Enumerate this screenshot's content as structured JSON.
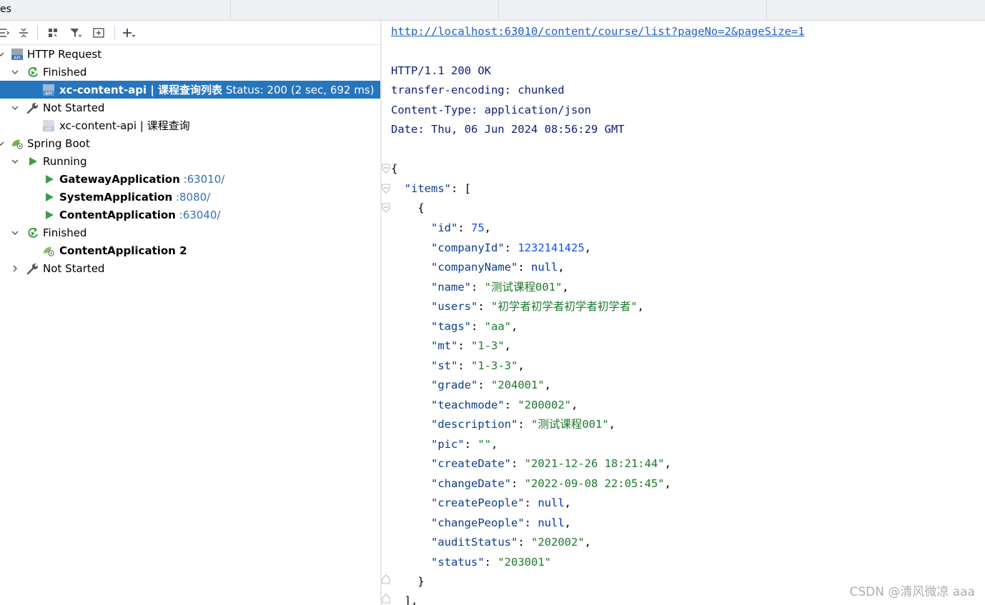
{
  "tabs": [
    "es",
    "",
    "",
    ""
  ],
  "toolbar": {
    "buttons": [
      "expand-all-icon",
      "collapse-all-icon",
      "group-icon",
      "filter-icon",
      "new-window-icon",
      "add-icon"
    ]
  },
  "tree": {
    "http_request": "HTTP Request",
    "finished": "Finished",
    "selected_request_name": "xc-content-api",
    "selected_request_sep": " | ",
    "selected_request_desc": "课程查询列表",
    "selected_request_status": " Status: 200 (2 sec, 692 ms)",
    "not_started": "Not Started",
    "pending_request_name": "xc-content-api",
    "pending_request_sep": " | ",
    "pending_request_desc": "课程查询",
    "spring_boot": "Spring Boot",
    "running": "Running",
    "apps": [
      {
        "name": "GatewayApplication",
        "port": " :63010/"
      },
      {
        "name": "SystemApplication",
        "port": " :8080/"
      },
      {
        "name": "ContentApplication",
        "port": " :63040/"
      }
    ],
    "finished2": "Finished",
    "finished_app": "ContentApplication 2",
    "not_started2": "Not Started"
  },
  "response": {
    "url": "http://localhost:63010/content/course/list?pageNo=2&pageSize=1",
    "status_line": "HTTP/1.1 200 OK",
    "headers": [
      "transfer-encoding: chunked",
      "Content-Type: application/json",
      "Date: Thu, 06 Jun 2024 08:56:29 GMT"
    ],
    "open_brace": "{",
    "items_key": "\"items\"",
    "items_open": ": [",
    "item_open": "{",
    "fields": [
      {
        "key": "\"id\"",
        "val": "75",
        "t": "n",
        "comma": ","
      },
      {
        "key": "\"companyId\"",
        "val": "1232141425",
        "t": "n",
        "comma": ","
      },
      {
        "key": "\"companyName\"",
        "val": "null",
        "t": "kw",
        "comma": ","
      },
      {
        "key": "\"name\"",
        "val": "\"测试课程001\"",
        "t": "s",
        "comma": ","
      },
      {
        "key": "\"users\"",
        "val": "\"初学者初学者初学者初学者\"",
        "t": "s",
        "comma": ","
      },
      {
        "key": "\"tags\"",
        "val": "\"aa\"",
        "t": "s",
        "comma": ","
      },
      {
        "key": "\"mt\"",
        "val": "\"1-3\"",
        "t": "s",
        "comma": ","
      },
      {
        "key": "\"st\"",
        "val": "\"1-3-3\"",
        "t": "s",
        "comma": ","
      },
      {
        "key": "\"grade\"",
        "val": "\"204001\"",
        "t": "s",
        "comma": ","
      },
      {
        "key": "\"teachmode\"",
        "val": "\"200002\"",
        "t": "s",
        "comma": ","
      },
      {
        "key": "\"description\"",
        "val": "\"测试课程001\"",
        "t": "s",
        "comma": ","
      },
      {
        "key": "\"pic\"",
        "val": "\"\"",
        "t": "s",
        "comma": ","
      },
      {
        "key": "\"createDate\"",
        "val": "\"2021-12-26 18:21:44\"",
        "t": "s",
        "comma": ","
      },
      {
        "key": "\"changeDate\"",
        "val": "\"2022-09-08 22:05:45\"",
        "t": "s",
        "comma": ","
      },
      {
        "key": "\"createPeople\"",
        "val": "null",
        "t": "kw",
        "comma": ","
      },
      {
        "key": "\"changePeople\"",
        "val": "null",
        "t": "kw",
        "comma": ","
      },
      {
        "key": "\"auditStatus\"",
        "val": "\"202002\"",
        "t": "s",
        "comma": ","
      },
      {
        "key": "\"status\"",
        "val": "\"203001\"",
        "t": "s",
        "comma": ""
      }
    ],
    "item_close": "}",
    "items_close": "],"
  },
  "watermark": "CSDN @清风微凉 aaa",
  "colors": {
    "selection": "#2675bf",
    "port": "#2f6fb5",
    "run_green": "#3f9b4a",
    "json_string": "#1c7a2c",
    "json_number": "#1750eb",
    "json_keyword": "#0033b3"
  }
}
